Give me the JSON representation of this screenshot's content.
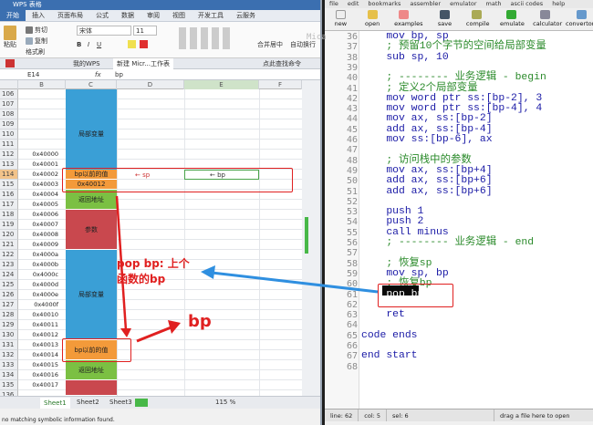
{
  "xl": {
    "title": "WPS 表格",
    "tabs": [
      "开始",
      "插入",
      "页面布局",
      "公式",
      "数据",
      "审阅",
      "视图",
      "开发工具",
      "云服务"
    ],
    "ribbon": {
      "cut": "剪切",
      "paste": "粘贴",
      "copy": "复制",
      "format_painter": "格式刷",
      "font": "宋体",
      "size": "11",
      "merge": "合并居中",
      "wrap": "自动换行"
    },
    "doctabs": [
      "我的WPS",
      "新建 Micr...工作表"
    ],
    "tab_search": "点此查找命令",
    "namebox": "E14",
    "fx": "fx",
    "formula": "bp",
    "cols": [
      "B",
      "C",
      "D",
      "E",
      "F"
    ],
    "rows": [
      "106",
      "107",
      "108",
      "109",
      "110",
      "111",
      "112",
      "113",
      "114",
      "115",
      "116",
      "117",
      "118",
      "119",
      "120",
      "121",
      "122",
      "123",
      "124",
      "125",
      "126",
      "127",
      "128",
      "129",
      "130",
      "131",
      "132",
      "133",
      "134",
      "135",
      "136"
    ],
    "addrs": [
      "",
      "",
      "",
      "",
      "",
      "",
      "0x40000",
      "0x40001",
      "0x40002",
      "0x40003",
      "0x40004",
      "0x40005",
      "0x40006",
      "0x40007",
      "0x40008",
      "0x40009",
      "0x4000a",
      "0x4000b",
      "0x4000c",
      "0x4000d",
      "0x4000e",
      "0x4000f",
      "0x40010",
      "0x40011",
      "0x40012",
      "0x40013",
      "0x40014",
      "0x40015",
      "0x40016",
      "0x40017",
      ""
    ],
    "blocks": {
      "local": "局部变量",
      "bp_prev": "bp以前的值",
      "bp_addr": "0x40012",
      "ret": "返回地址",
      "params": "参数",
      "local2": "局部变量",
      "bp_prev2": "bp以前的值",
      "ret2": "返回地址"
    },
    "d_arrow": "←  sp",
    "e_arrow": "←  bp",
    "annot_pop": "pop bp: 上个",
    "annot_pop2": "函数的bp",
    "annot_bp": "bp",
    "sheets": [
      "Sheet1",
      "Sheet2",
      "Sheet3"
    ],
    "zoom": "115 %",
    "status_left": "no matching symbolic information found."
  },
  "ed": {
    "menu": [
      "file",
      "edit",
      "bookmarks",
      "assembler",
      "emulator",
      "math",
      "ascii codes",
      "help"
    ],
    "toolbar": [
      "new",
      "open",
      "examples",
      "save",
      "compile",
      "emulate",
      "calculator",
      "convertor"
    ],
    "lines": [
      {
        "n": "36",
        "t": "    mov bp, sp",
        "c": false
      },
      {
        "n": "37",
        "t": "    ; 预留10个字节的空间给局部变量",
        "c": true
      },
      {
        "n": "38",
        "t": "    sub sp, 10",
        "c": false
      },
      {
        "n": "39",
        "t": "",
        "c": false
      },
      {
        "n": "40",
        "t": "    ; -------- 业务逻辑 - begin",
        "c": true
      },
      {
        "n": "41",
        "t": "    ; 定义2个局部变量",
        "c": true
      },
      {
        "n": "42",
        "t": "    mov word ptr ss:[bp-2], 3",
        "c": false
      },
      {
        "n": "43",
        "t": "    mov word ptr ss:[bp-4], 4",
        "c": false
      },
      {
        "n": "44",
        "t": "    mov ax, ss:[bp-2]",
        "c": false
      },
      {
        "n": "45",
        "t": "    add ax, ss:[bp-4]",
        "c": false
      },
      {
        "n": "46",
        "t": "    mov ss:[bp-6], ax",
        "c": false
      },
      {
        "n": "47",
        "t": "",
        "c": false
      },
      {
        "n": "48",
        "t": "    ; 访问栈中的参数",
        "c": true
      },
      {
        "n": "49",
        "t": "    mov ax, ss:[bp+4]",
        "c": false
      },
      {
        "n": "50",
        "t": "    add ax, ss:[bp+6]",
        "c": false
      },
      {
        "n": "51",
        "t": "    add ax, ss:[bp+6]",
        "c": false
      },
      {
        "n": "52",
        "t": "",
        "c": false
      },
      {
        "n": "53",
        "t": "    push 1",
        "c": false
      },
      {
        "n": "54",
        "t": "    push 2",
        "c": false
      },
      {
        "n": "55",
        "t": "    call minus",
        "c": false
      },
      {
        "n": "56",
        "t": "    ; -------- 业务逻辑 - end",
        "c": true
      },
      {
        "n": "57",
        "t": "",
        "c": false
      },
      {
        "n": "58",
        "t": "    ; 恢复sp",
        "c": true
      },
      {
        "n": "59",
        "t": "    mov sp, bp",
        "c": false
      },
      {
        "n": "60",
        "t": "    ; 恢复bp",
        "c": true
      },
      {
        "n": "61",
        "t": "    pop bp",
        "c": false
      },
      {
        "n": "62",
        "t": "",
        "c": false
      },
      {
        "n": "63",
        "t": "    ret",
        "c": false
      },
      {
        "n": "64",
        "t": "",
        "c": false
      },
      {
        "n": "65",
        "t": "code ends",
        "c": false
      },
      {
        "n": "66",
        "t": "",
        "c": false
      },
      {
        "n": "67",
        "t": "end start",
        "c": false
      },
      {
        "n": "68",
        "t": "",
        "c": false
      }
    ],
    "status": {
      "line": "line: 62",
      "col": "col: 5",
      "sel": "sel: 6",
      "drag": "drag a file here to open"
    },
    "bg_text": "Mica"
  },
  "colors": {
    "accent": "#3b6fb0",
    "stack_blue": "#3a9fd6",
    "stack_orange": "#f39a3a",
    "stack_green": "#7bc043",
    "stack_red": "#c9484e",
    "annot_red": "#e02020",
    "annot_blue": "#2f8fe0"
  }
}
